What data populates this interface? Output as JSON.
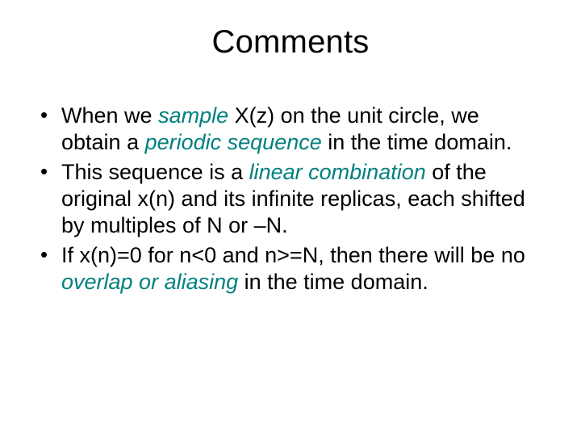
{
  "title": "Comments",
  "bullets": [
    {
      "segments": [
        {
          "text": "When we ",
          "em": false
        },
        {
          "text": "sample",
          "em": true
        },
        {
          "text": " X(z) on the unit circle, we obtain a ",
          "em": false
        },
        {
          "text": "periodic sequence",
          "em": true
        },
        {
          "text": " in the time domain.",
          "em": false
        }
      ]
    },
    {
      "segments": [
        {
          "text": "This sequence is a ",
          "em": false
        },
        {
          "text": "linear combination",
          "em": true
        },
        {
          "text": " of the original x(n) and its infinite replicas, each shifted by multiples of N or –N.",
          "em": false
        }
      ]
    },
    {
      "segments": [
        {
          "text": "If x(n)=0 for n<0 and n>=N, then there will be no ",
          "em": false
        },
        {
          "text": "overlap or aliasing",
          "em": true
        },
        {
          "text": " in the time domain.",
          "em": false
        }
      ]
    }
  ]
}
